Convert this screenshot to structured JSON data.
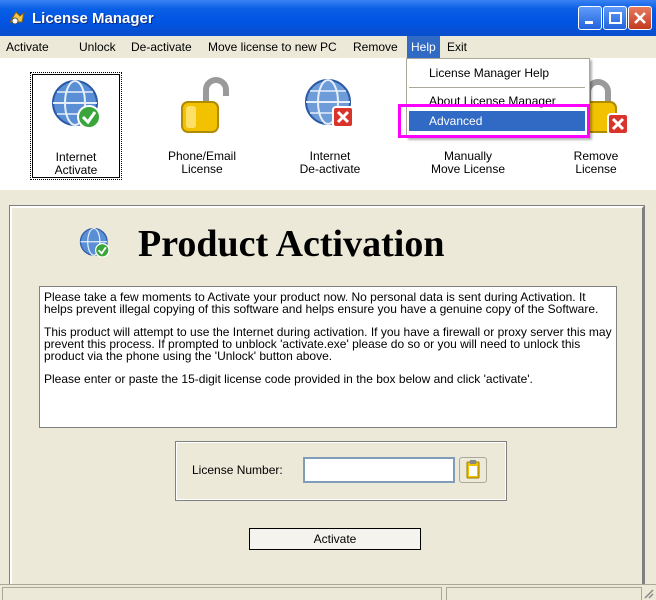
{
  "window": {
    "title": "License Manager"
  },
  "menu": {
    "items": [
      "Activate",
      "Unlock",
      "De-activate",
      "Move license to new PC",
      "Remove",
      "Help",
      "Exit"
    ],
    "active": "Help",
    "dropdown": [
      "License Manager Help",
      "About License Manager",
      "Advanced"
    ],
    "highlighted": "Advanced"
  },
  "toolbar": {
    "buttons": [
      {
        "label": "Internet\nActivate",
        "icon": "globe-check-icon"
      },
      {
        "label": "Phone/Email\nLicense",
        "icon": "padlock-open-icon"
      },
      {
        "label": "Internet\nDe-activate",
        "icon": "globe-x-icon"
      },
      {
        "label": "Manually\nMove License",
        "icon": "move-icon"
      },
      {
        "label": "Remove\nLicense",
        "icon": "padlock-x-icon"
      }
    ],
    "lines": [
      [
        "Internet",
        "Activate"
      ],
      [
        "Phone/Email",
        "License"
      ],
      [
        "Internet",
        "De-activate"
      ],
      [
        "Manually",
        "Move License"
      ],
      [
        "Remove",
        "License"
      ]
    ]
  },
  "panel": {
    "title": "Product Activation",
    "paragraphs": [
      "Please take a few moments to Activate your product now.  No personal data is sent during Activation.  It helps prevent illegal copying of this software and helps ensure you have a genuine copy of the Software.",
      "This product will attempt to use the Internet during activation.  If you have a firewall or proxy server this may prevent this process.  If prompted to unblock 'activate.exe' please do so or you will need to unlock this product via the phone using the 'Unlock' button above.",
      "Please enter or paste the 15-digit license code provided in the box below and click 'activate'."
    ],
    "license_label": "License Number:",
    "license_value": "",
    "activate_label": "Activate"
  },
  "colors": {
    "titlebar": "#0054E3",
    "menu_highlight": "#316AC5",
    "annotation": "#FF00FF",
    "window_bg": "#ECE9D8"
  }
}
